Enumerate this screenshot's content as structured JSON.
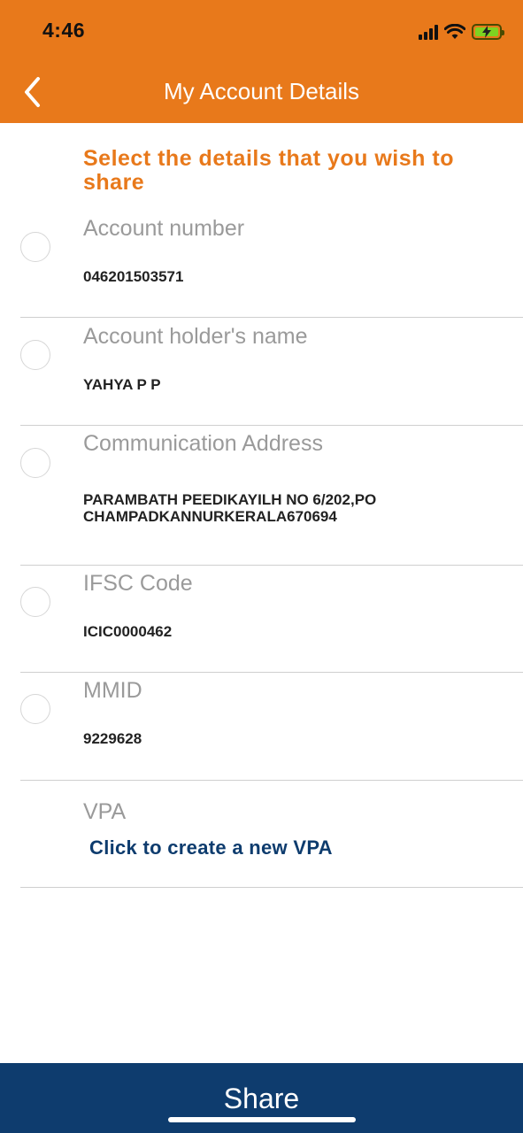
{
  "status_bar": {
    "time": "4:46"
  },
  "header": {
    "title": "My Account Details"
  },
  "instruction": "Select the details that you wish to share",
  "fields": [
    {
      "label": "Account number",
      "value": "046201503571"
    },
    {
      "label": "Account holder's name",
      "value": "YAHYA P P"
    },
    {
      "label": "Communication Address",
      "value_line1": "PARAMBATH PEEDIKAYILH NO 6/202,PO",
      "value_line2": "CHAMPADKANNURKERALA670694"
    },
    {
      "label": "IFSC Code",
      "value": "ICIC0000462"
    },
    {
      "label": "MMID",
      "value": "9229628"
    },
    {
      "label": "VPA",
      "link": "Click to create a new VPA"
    }
  ],
  "footer": {
    "share_label": "Share"
  },
  "colors": {
    "header_bg": "#E8791B",
    "accent_orange": "#E8791B",
    "footer_bg": "#0E3C6E",
    "link_blue": "#0E3C6E"
  },
  "icons": {
    "back": "chevron-left-icon",
    "signal": "cellular-signal-icon",
    "wifi": "wifi-icon",
    "battery": "battery-charging-icon"
  }
}
